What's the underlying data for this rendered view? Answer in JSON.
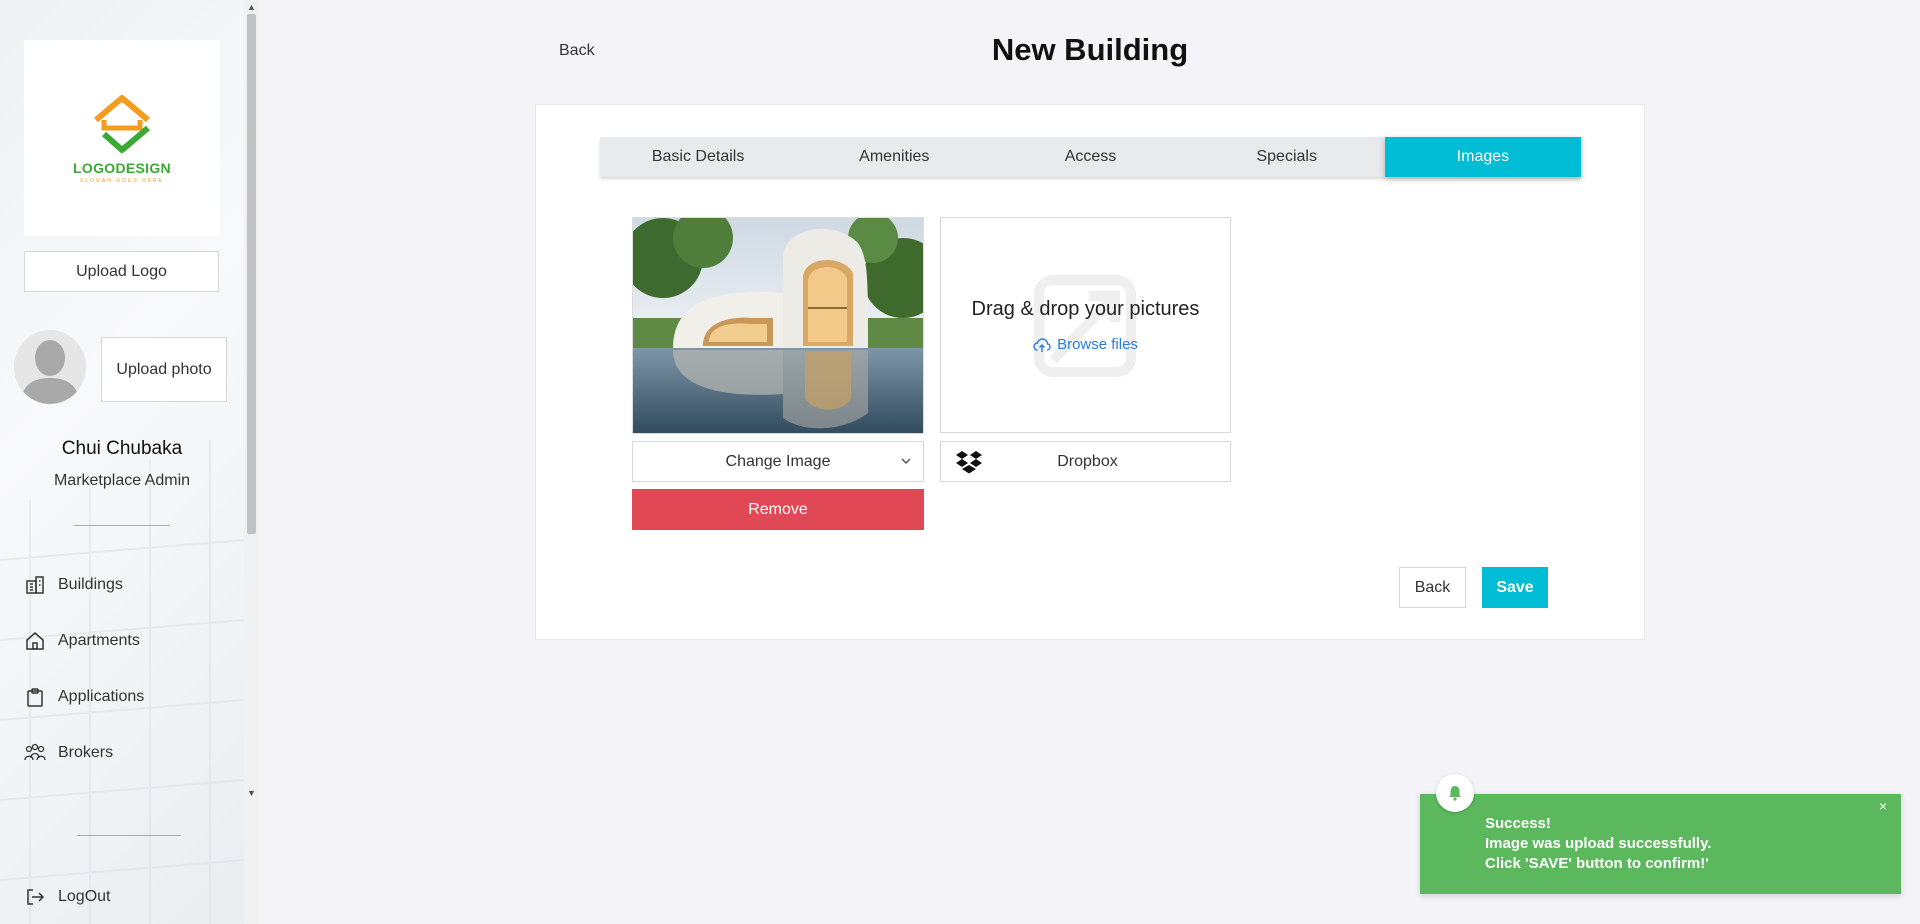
{
  "sidebar": {
    "logo": {
      "text": "LOGODESIGN",
      "slogan": "SLOGAN GOES HERE"
    },
    "upload_logo_label": "Upload Logo",
    "upload_photo_label": "Upload photo",
    "user": {
      "name": "Chui Chubaka",
      "role": "Marketplace Admin"
    },
    "nav": [
      {
        "label": "Buildings",
        "icon": "building-icon"
      },
      {
        "label": "Apartments",
        "icon": "home-icon"
      },
      {
        "label": "Applications",
        "icon": "clipboard-icon"
      },
      {
        "label": "Brokers",
        "icon": "people-icon"
      }
    ],
    "logout_label": "LogOut"
  },
  "header": {
    "back_label": "Back",
    "title": "New Building"
  },
  "tabs": [
    {
      "label": "Basic Details",
      "active": false
    },
    {
      "label": "Amenities",
      "active": false
    },
    {
      "label": "Access",
      "active": false
    },
    {
      "label": "Specials",
      "active": false
    },
    {
      "label": "Images",
      "active": true
    }
  ],
  "images": {
    "change_image_label": "Change Image",
    "remove_label": "Remove",
    "dropzone_text": "Drag & drop your pictures",
    "browse_label": "Browse files",
    "dropbox_label": "Dropbox"
  },
  "actions": {
    "back_label": "Back",
    "save_label": "Save"
  },
  "toast": {
    "title": "Success!",
    "line1": "Image was upload successfully.",
    "line2": "Click 'SAVE' button to confirm!'",
    "close": "×"
  },
  "colors": {
    "accent": "#00bcd4",
    "danger": "#e04856",
    "success": "#5cb85c",
    "link": "#2a7de1"
  }
}
